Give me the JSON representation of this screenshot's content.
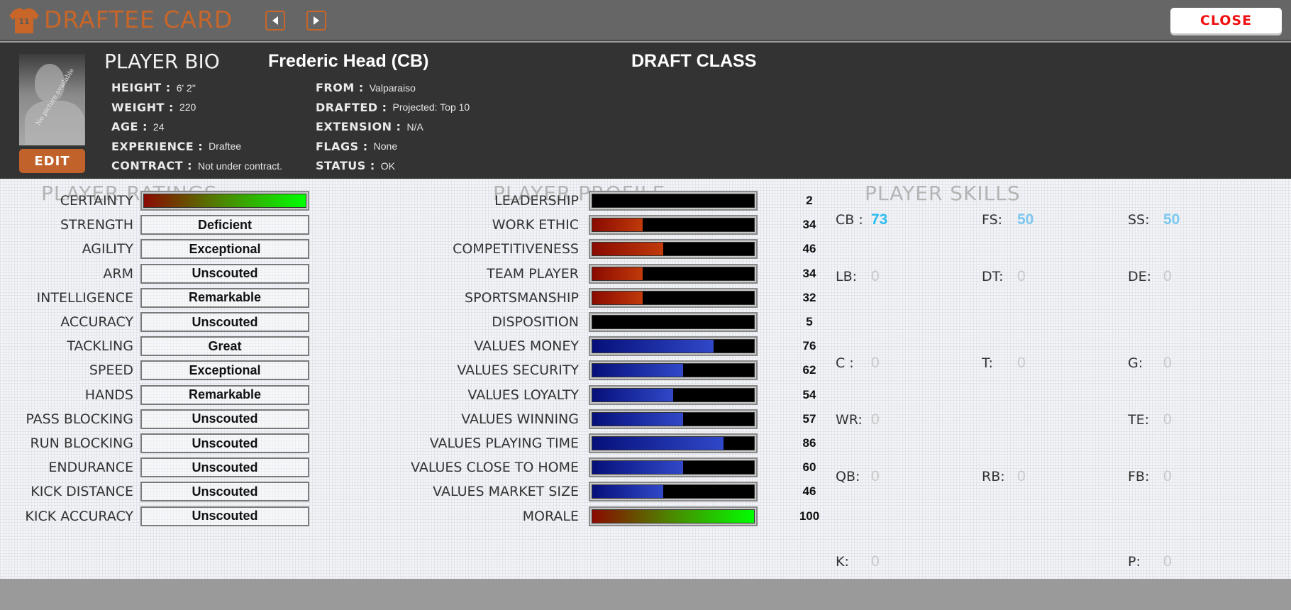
{
  "titlebar": {
    "title": "DRAFTEE CARD",
    "jersey_number": "11",
    "prev_icon": "chevron-left-icon",
    "next_icon": "chevron-right-icon",
    "close_label": "CLOSE",
    "accent_color": "#c8662a",
    "close_color": "#ee1111"
  },
  "bio": {
    "heading": "PLAYER BIO",
    "player_name": "Frederic Head (CB)",
    "draft_class_label": "DRAFT CLASS",
    "no_picture_text": "No picture available",
    "edit_label": "EDIT",
    "left_fields": [
      {
        "label": "HEIGHT :",
        "value": "6' 2\""
      },
      {
        "label": "WEIGHT :",
        "value": "220"
      },
      {
        "label": "AGE :",
        "value": "24"
      },
      {
        "label": "EXPERIENCE :",
        "value": "Draftee"
      },
      {
        "label": "CONTRACT :",
        "value": "Not under contract."
      }
    ],
    "right_fields": [
      {
        "label": "FROM :",
        "value": "Valparaiso"
      },
      {
        "label": "DRAFTED :",
        "value": "Projected: Top 10"
      },
      {
        "label": "EXTENSION :",
        "value": "N/A"
      },
      {
        "label": "FLAGS :",
        "value": "None"
      },
      {
        "label": "STATUS :",
        "value": "OK"
      }
    ]
  },
  "ratings": {
    "title": "PLAYER RATINGS",
    "certainty": {
      "label": "CERTAINTY",
      "fill": 1.0
    },
    "items": [
      {
        "label": "STRENGTH",
        "value": "Deficient"
      },
      {
        "label": "AGILITY",
        "value": "Exceptional"
      },
      {
        "label": "ARM",
        "value": "Unscouted"
      },
      {
        "label": "INTELLIGENCE",
        "value": "Remarkable"
      },
      {
        "label": "ACCURACY",
        "value": "Unscouted"
      },
      {
        "label": "TACKLING",
        "value": "Great"
      },
      {
        "label": "SPEED",
        "value": "Exceptional"
      },
      {
        "label": "HANDS",
        "value": "Remarkable"
      },
      {
        "label": "PASS BLOCKING",
        "value": "Unscouted"
      },
      {
        "label": "RUN BLOCKING",
        "value": "Unscouted"
      },
      {
        "label": "ENDURANCE",
        "value": "Unscouted"
      },
      {
        "label": "KICK DISTANCE",
        "value": "Unscouted"
      },
      {
        "label": "KICK ACCURACY",
        "value": "Unscouted"
      }
    ]
  },
  "profile": {
    "title": "PLAYER PROFILE",
    "items": [
      {
        "label": "LEADERSHIP",
        "value": "2",
        "fill": 0.0,
        "color": "red"
      },
      {
        "label": "WORK ETHIC",
        "value": "34",
        "fill": 0.31,
        "color": "red"
      },
      {
        "label": "COMPETITIVENESS",
        "value": "46",
        "fill": 0.44,
        "color": "red"
      },
      {
        "label": "TEAM PLAYER",
        "value": "34",
        "fill": 0.31,
        "color": "red"
      },
      {
        "label": "SPORTSMANSHIP",
        "value": "32",
        "fill": 0.31,
        "color": "red"
      },
      {
        "label": "DISPOSITION",
        "value": "5",
        "fill": 0.0,
        "color": "red"
      },
      {
        "label": "VALUES MONEY",
        "value": "76",
        "fill": 0.75,
        "color": "blue"
      },
      {
        "label": "VALUES SECURITY",
        "value": "62",
        "fill": 0.56,
        "color": "blue"
      },
      {
        "label": "VALUES LOYALTY",
        "value": "54",
        "fill": 0.5,
        "color": "blue"
      },
      {
        "label": "VALUES WINNING",
        "value": "57",
        "fill": 0.56,
        "color": "blue"
      },
      {
        "label": "VALUES PLAYING TIME",
        "value": "86",
        "fill": 0.81,
        "color": "blue"
      },
      {
        "label": "VALUES CLOSE TO HOME",
        "value": "60",
        "fill": 0.56,
        "color": "blue"
      },
      {
        "label": "VALUES MARKET SIZE",
        "value": "46",
        "fill": 0.44,
        "color": "blue"
      },
      {
        "label": "MORALE",
        "value": "100",
        "fill": 1.0,
        "color": "grad"
      }
    ]
  },
  "skills": {
    "title": "PLAYER SKILLS",
    "active_color": "#2bbcf0",
    "secondary_color": "#7cc8f0",
    "inactive_color": "#c8c8c8",
    "rows": [
      [
        {
          "label": "CB :",
          "value": "73",
          "state": "active"
        },
        {
          "label": "FS:",
          "value": "50",
          "state": "secondary"
        },
        {
          "label": "SS:",
          "value": "50",
          "state": "secondary"
        }
      ],
      [
        {
          "label": "LB:",
          "value": "0",
          "state": "inactive"
        },
        {
          "label": "DT:",
          "value": "0",
          "state": "inactive"
        },
        {
          "label": "DE:",
          "value": "0",
          "state": "inactive"
        }
      ],
      [
        {
          "label": "C :",
          "value": "0",
          "state": "inactive"
        },
        {
          "label": "T:",
          "value": "0",
          "state": "inactive"
        },
        {
          "label": "G:",
          "value": "0",
          "state": "inactive"
        }
      ],
      [
        {
          "label": "WR:",
          "value": "0",
          "state": "inactive"
        },
        null,
        {
          "label": "TE:",
          "value": "0",
          "state": "inactive"
        }
      ],
      [
        {
          "label": "QB:",
          "value": "0",
          "state": "inactive"
        },
        {
          "label": "RB:",
          "value": "0",
          "state": "inactive"
        },
        {
          "label": "FB:",
          "value": "0",
          "state": "inactive"
        }
      ],
      [
        {
          "label": "K:",
          "value": "0",
          "state": "inactive"
        },
        null,
        {
          "label": "P:",
          "value": "0",
          "state": "inactive"
        }
      ]
    ]
  }
}
